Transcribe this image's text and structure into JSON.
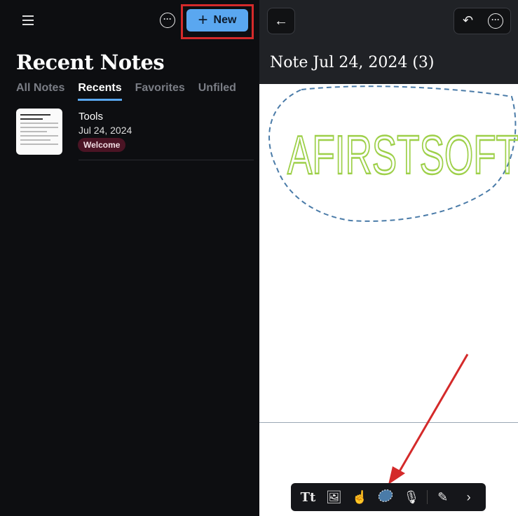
{
  "left": {
    "title": "Recent Notes",
    "new_label": "New",
    "tabs": [
      "All Notes",
      "Recents",
      "Favorites",
      "Unfiled"
    ],
    "active_tab": "Recents",
    "notes": [
      {
        "title": "Tools",
        "date": "Jul 24, 2024",
        "tag": "Welcome"
      }
    ]
  },
  "right": {
    "note_title": "Note Jul 24, 2024 (3)",
    "drawing_text": "AFIRSTSOFT",
    "toolbar": [
      "text-format-icon",
      "image-icon",
      "hand-touch-icon",
      "lasso-icon",
      "microphone-icon",
      "pencil-icon",
      "chevron-right-icon"
    ]
  },
  "colors": {
    "accent": "#5aa7f0",
    "ink": "#9ed04a",
    "lasso": "#4a7ba8",
    "annotation": "#d42a2a"
  }
}
